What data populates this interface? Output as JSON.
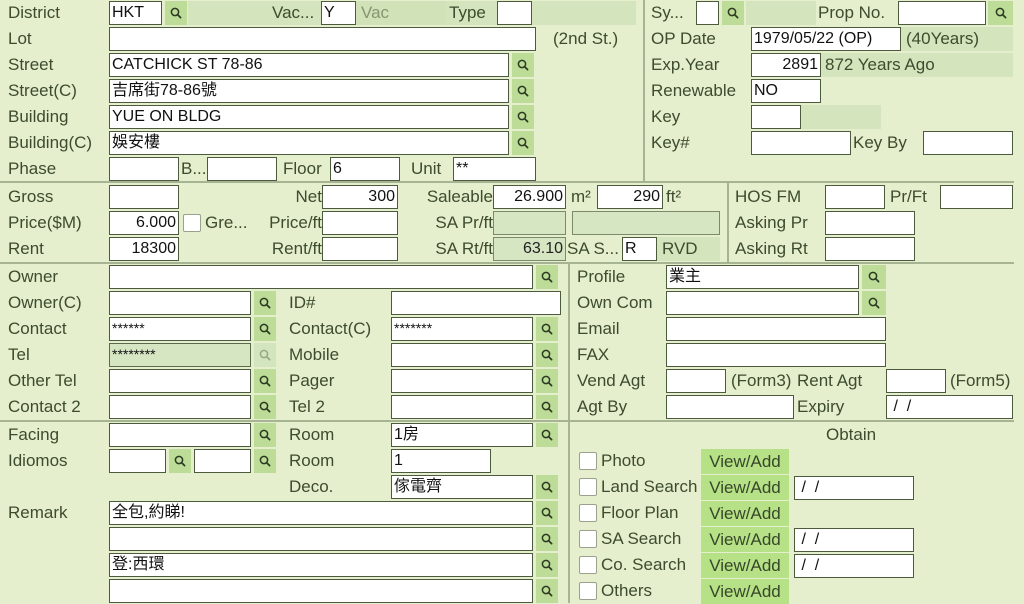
{
  "property": {
    "district": {
      "label": "District",
      "value": "HKT"
    },
    "vacant": {
      "label": "Vac...",
      "value": "Y",
      "status": "Vac"
    },
    "type": {
      "label": "Type",
      "value": ""
    },
    "lot": {
      "label": "Lot",
      "value": "",
      "note": "(2nd St.)"
    },
    "street": {
      "label": "Street",
      "value": "CATCHICK ST 78-86"
    },
    "street_c": {
      "label": "Street(C)",
      "value": "吉席街78-86號"
    },
    "building": {
      "label": "Building",
      "value": "YUE ON BLDG"
    },
    "building_c": {
      "label": "Building(C)",
      "value": "娛安樓"
    },
    "phase": {
      "label": "Phase",
      "value": ""
    },
    "block": {
      "label": "B...",
      "value": ""
    },
    "floor": {
      "label": "Floor",
      "value": "6"
    },
    "unit": {
      "label": "Unit",
      "value": "**"
    }
  },
  "lease": {
    "sy": {
      "label": "Sy...",
      "value": ""
    },
    "prop_no": {
      "label": "Prop No.",
      "value": ""
    },
    "op_date": {
      "label": "OP Date",
      "value": "1979/05/22 (OP)",
      "age": "(40Years)"
    },
    "exp_year": {
      "label": "Exp.Year",
      "value": "2891",
      "note": "872 Years Ago"
    },
    "renewable": {
      "label": "Renewable",
      "value": "NO"
    },
    "key": {
      "label": "Key",
      "value": ""
    },
    "key_no": {
      "label": "Key#",
      "value": ""
    },
    "key_by": {
      "label": "Key By",
      "value": ""
    }
  },
  "area_price": {
    "gross": {
      "label": "Gross",
      "value": ""
    },
    "net": {
      "label": "Net",
      "value": "300"
    },
    "saleable": {
      "label": "Saleable",
      "value_m2": "26.900",
      "unit_m2": "m²",
      "value_ft2": "290",
      "unit_ft2": "ft²"
    },
    "price": {
      "label": "Price($M)",
      "value": "6.000"
    },
    "gross_check": {
      "label": "Gre...",
      "checked": false
    },
    "price_ft": {
      "label": "Price/ft",
      "value": ""
    },
    "sa_pr_ft": {
      "label": "SA Pr/ft",
      "value": "",
      "extra": ""
    },
    "rent": {
      "label": "Rent",
      "value": "18300"
    },
    "rent_ft": {
      "label": "Rent/ft",
      "value": ""
    },
    "sa_rt_ft": {
      "label": "SA Rt/ft",
      "value": "63.10"
    },
    "sa_s": {
      "label": "SA S...",
      "value": "R",
      "status": "RVD"
    },
    "hos_fm": {
      "label": "HOS FM",
      "value": ""
    },
    "pr_ft": {
      "label": "Pr/Ft",
      "value": ""
    },
    "asking_pr": {
      "label": "Asking Pr",
      "value": ""
    },
    "asking_rt": {
      "label": "Asking Rt",
      "value": ""
    }
  },
  "owner": {
    "owner": {
      "label": "Owner",
      "value": ""
    },
    "owner_c": {
      "label": "Owner(C)",
      "value": ""
    },
    "id_no": {
      "label": "ID#",
      "value": ""
    },
    "contact": {
      "label": "Contact",
      "value": "******"
    },
    "contact_c": {
      "label": "Contact(C)",
      "value": "*******"
    },
    "tel": {
      "label": "Tel",
      "value": "********"
    },
    "mobile": {
      "label": "Mobile",
      "value": ""
    },
    "other_tel": {
      "label": "Other Tel",
      "value": ""
    },
    "pager": {
      "label": "Pager",
      "value": ""
    },
    "contact2": {
      "label": "Contact 2",
      "value": ""
    },
    "tel2": {
      "label": "Tel 2",
      "value": ""
    },
    "profile": {
      "label": "Profile",
      "value": "業主"
    },
    "own_com": {
      "label": "Own Com",
      "value": ""
    },
    "email": {
      "label": "Email",
      "value": ""
    },
    "fax": {
      "label": "FAX",
      "value": ""
    },
    "vend_agt": {
      "label": "Vend Agt",
      "value": "",
      "form": "(Form3)"
    },
    "rent_agt": {
      "label": "Rent Agt",
      "value": "",
      "form": "(Form5)"
    },
    "agt_by": {
      "label": "Agt By",
      "value": ""
    },
    "expiry": {
      "label": "Expiry",
      "value": " /  /"
    }
  },
  "details": {
    "facing": {
      "label": "Facing",
      "value": ""
    },
    "idiomos": {
      "label": "Idiomos",
      "value1": "",
      "value2": ""
    },
    "room": {
      "label": "Room",
      "value": "1房"
    },
    "room2": {
      "label": "Room",
      "value": "1"
    },
    "deco": {
      "label": "Deco.",
      "value": "傢電齊"
    },
    "remark": {
      "label": "Remark",
      "lines": [
        "全包,約睇!",
        "",
        "登:西環",
        ""
      ]
    }
  },
  "documents": {
    "header": "Obtain",
    "view_add_label": "View/Add",
    "items": [
      {
        "label": "Photo",
        "checked": false,
        "date": null
      },
      {
        "label": "Land Search",
        "checked": false,
        "date": " /  /"
      },
      {
        "label": "Floor Plan",
        "checked": false,
        "date": null
      },
      {
        "label": "SA Search",
        "checked": false,
        "date": " /  /"
      },
      {
        "label": "Co. Search",
        "checked": false,
        "date": " /  /"
      },
      {
        "label": "Others",
        "checked": false,
        "date": null
      }
    ]
  },
  "icons": {
    "search": "search-icon"
  }
}
